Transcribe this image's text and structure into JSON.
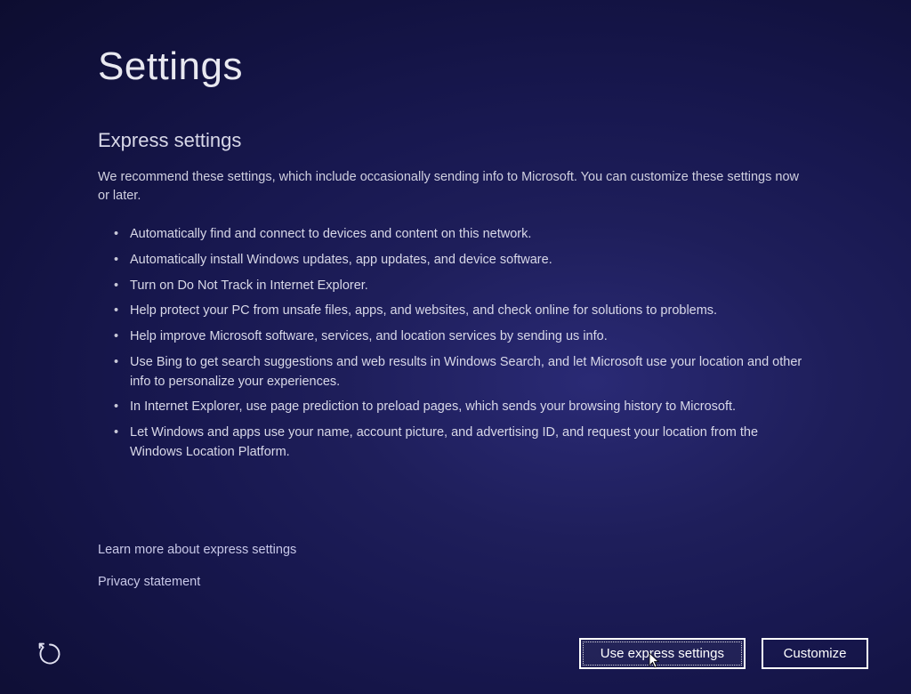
{
  "page": {
    "title": "Settings"
  },
  "section": {
    "title": "Express settings",
    "description": "We recommend these settings, which include occasionally sending info to Microsoft. You can customize these settings now or later."
  },
  "bullets": [
    "Automatically find and connect to devices and content on this network.",
    "Automatically install Windows updates, app updates, and device software.",
    "Turn on Do Not Track in Internet Explorer.",
    "Help protect your PC from unsafe files, apps, and websites, and check online for solutions to problems.",
    "Help improve Microsoft software, services, and location services by sending us info.",
    "Use Bing to get search suggestions and web results in Windows Search, and let Microsoft use your location and other info to personalize your experiences.",
    "In Internet Explorer, use page prediction to preload pages, which sends your browsing history to Microsoft.",
    "Let Windows and apps use your name, account picture, and advertising ID, and request your location from the Windows Location Platform."
  ],
  "links": {
    "learn_more": "Learn more about express settings",
    "privacy": "Privacy statement"
  },
  "buttons": {
    "express": "Use express settings",
    "customize": "Customize"
  }
}
